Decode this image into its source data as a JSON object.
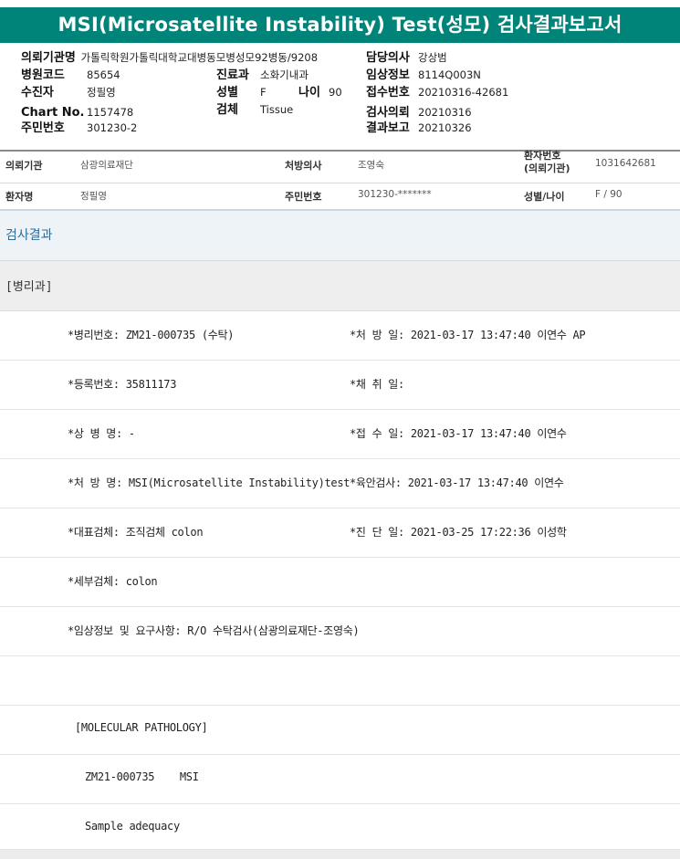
{
  "title": "MSI(Microsatellite Instability) Test(성모) 검사결과보고서",
  "header": {
    "left": [
      {
        "label": "의뢰기관명",
        "value": "가톨릭학원가톨릭대학교대병동모병성모92병동/9208"
      },
      {
        "label": "병원코드",
        "value": "85654"
      },
      {
        "label": "수진자",
        "value": "정필영"
      },
      {
        "label": "Chart No.",
        "value": "1157478"
      },
      {
        "label": "주민번호",
        "value": "301230-2"
      }
    ],
    "middle": [
      {
        "label": "진료과",
        "value": "소화기내과"
      },
      {
        "label": "성별",
        "value": "F"
      },
      {
        "label": "검체",
        "value": "Tissue"
      }
    ],
    "age": {
      "label": "나이",
      "value": "90"
    },
    "right": [
      {
        "label": "담당의사",
        "value": "강상범"
      },
      {
        "label": "임상정보",
        "value": "8114Q003N"
      },
      {
        "label": "접수번호",
        "value": "20210316-42681"
      },
      {
        "label": "검사의뢰",
        "value": "20210316"
      },
      {
        "label": "결과보고",
        "value": "20210326"
      }
    ]
  },
  "patient": {
    "row1": [
      {
        "label": "의뢰기관",
        "value": "삼광의료재단"
      },
      {
        "label": "처방의사",
        "value": "조영숙"
      },
      {
        "label": "환자번호",
        "label2": "(의뢰기관)",
        "value": "1031642681"
      }
    ],
    "row2": [
      {
        "label": "환자명",
        "value": "정필영"
      },
      {
        "label": "주민번호",
        "value": "301230-*******"
      },
      {
        "label": "성별/나이",
        "value": "F / 90"
      }
    ]
  },
  "section_title": "검사결과",
  "department": "[병리과]",
  "results": [
    {
      "left": "*병리번호: ZM21-000735 (수탁)",
      "right": "*처 방 일: 2021-03-17 13:47:40  이연수 AP"
    },
    {
      "left": "*등록번호: 35811173",
      "right": "*채 취 일:"
    },
    {
      "left": "*상 병 명: -",
      "right": "*접 수 일: 2021-03-17 13:47:40  이연수"
    },
    {
      "left": "*처 방 명: MSI(Microsatellite Instability)test",
      "right": "*육안검사: 2021-03-17 13:47:40  이연수"
    },
    {
      "left": "*대표검체: 조직검체 colon",
      "right": "*진 단 일: 2021-03-25 17:22:36  이성학"
    },
    {
      "left": "*세부검체: colon",
      "right": ""
    },
    {
      "left": "*임상정보 및 요구사항: R/O 수탁검사(삼광의료재단-조영숙)",
      "right": ""
    },
    {
      "left": "",
      "right": ""
    }
  ],
  "report": {
    "heading": "[MOLECULAR PATHOLOGY]",
    "line1": "ZM21-000735    MSI",
    "line2": "Sample adequacy"
  }
}
